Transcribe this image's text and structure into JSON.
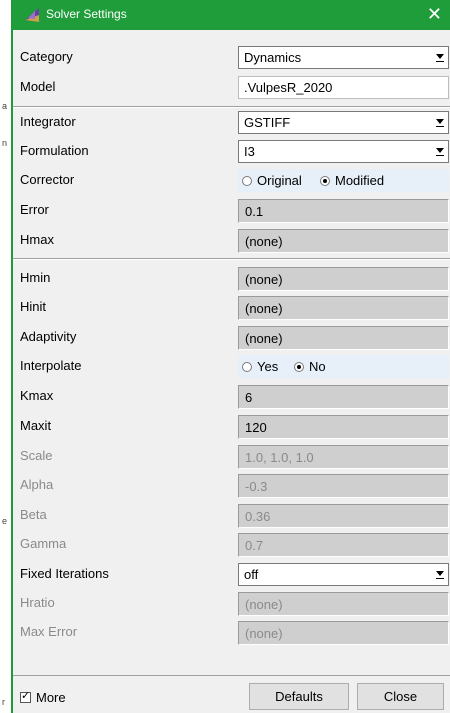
{
  "window": {
    "title": "Solver Settings",
    "close_glyph": "✕"
  },
  "left_strip": {
    "marks": [
      "a",
      "n",
      "e",
      "r"
    ]
  },
  "rows": {
    "category": {
      "label": "Category",
      "value": "Dynamics"
    },
    "model": {
      "label": "Model",
      "value": ".VulpesR_2020"
    },
    "integrator": {
      "label": "Integrator",
      "value": "GSTIFF"
    },
    "formulation": {
      "label": "Formulation",
      "value": "I3"
    },
    "corrector": {
      "label": "Corrector",
      "option1": "Original",
      "option2": "Modified",
      "selected": "Modified"
    },
    "error": {
      "label": "Error",
      "value": "0.1"
    },
    "hmax": {
      "label": "Hmax",
      "value": "(none)"
    },
    "hmin": {
      "label": "Hmin",
      "value": "(none)"
    },
    "hinit": {
      "label": "Hinit",
      "value": "(none)"
    },
    "adaptivity": {
      "label": "Adaptivity",
      "value": "(none)"
    },
    "interpolate": {
      "label": "Interpolate",
      "option1": "Yes",
      "option2": "No",
      "selected": "No"
    },
    "kmax": {
      "label": "Kmax",
      "value": "6"
    },
    "maxit": {
      "label": "Maxit",
      "value": "120"
    },
    "scale": {
      "label": "Scale",
      "value": "1.0, 1.0, 1.0"
    },
    "alpha": {
      "label": "Alpha",
      "value": "-0.3"
    },
    "beta": {
      "label": "Beta",
      "value": "0.36"
    },
    "gamma": {
      "label": "Gamma",
      "value": "0.7"
    },
    "fixed_iterations": {
      "label": "Fixed Iterations",
      "value": "off"
    },
    "hratio": {
      "label": "Hratio",
      "value": "(none)"
    },
    "max_error": {
      "label": "Max Error",
      "value": "(none)"
    }
  },
  "footer": {
    "more_label": "More",
    "more_checked": true,
    "defaults_label": "Defaults",
    "close_label": "Close"
  },
  "colors": {
    "titlebar": "#1f9d3b",
    "field_bg": "#cfcfcf",
    "radio_bg": "#e7f0f9"
  }
}
